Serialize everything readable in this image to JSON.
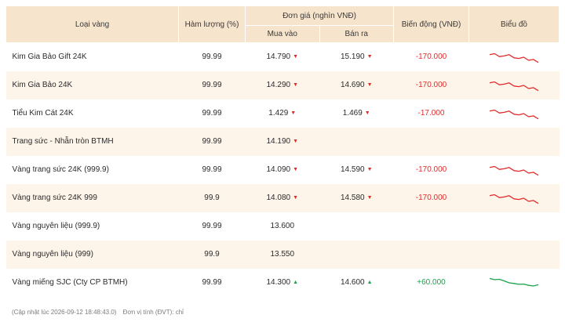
{
  "header": {
    "name": "Loại vàng",
    "purity": "Hàm lượng (%)",
    "price_group": "Đơn giá (nghìn VNĐ)",
    "buy": "Mua vào",
    "sell": "Bán ra",
    "change": "Biến động (VNĐ)",
    "chart": "Biểu đồ"
  },
  "rows": [
    {
      "name": "Kim Gia Bảo Gift 24K",
      "purity": "99.99",
      "buy": "14.790",
      "buy_dir": "down",
      "sell": "15.190",
      "sell_dir": "down",
      "change": "-170.000",
      "change_dir": "down",
      "trend_color": "#e02b2b",
      "trend": [
        0.3,
        0.22,
        0.45,
        0.4,
        0.3,
        0.55,
        0.6,
        0.5,
        0.75,
        0.68,
        0.92
      ]
    },
    {
      "name": "Kim Gia Bảo 24K",
      "purity": "99.99",
      "buy": "14.290",
      "buy_dir": "down",
      "sell": "14.690",
      "sell_dir": "down",
      "change": "-170.000",
      "change_dir": "down",
      "trend_color": "#e02b2b",
      "trend": [
        0.3,
        0.22,
        0.45,
        0.4,
        0.3,
        0.55,
        0.6,
        0.5,
        0.75,
        0.68,
        0.92
      ]
    },
    {
      "name": "Tiểu Kim Cát 24K",
      "purity": "99.99",
      "buy": "1.429",
      "buy_dir": "down",
      "sell": "1.469",
      "sell_dir": "down",
      "change": "-17.000",
      "change_dir": "down",
      "trend_color": "#e02b2b",
      "trend": [
        0.3,
        0.22,
        0.45,
        0.4,
        0.3,
        0.55,
        0.6,
        0.5,
        0.75,
        0.68,
        0.92
      ]
    },
    {
      "name": "Trang sức - Nhẫn tròn BTMH",
      "purity": "99.99",
      "buy": "14.190",
      "buy_dir": "down",
      "sell": "",
      "sell_dir": "",
      "change": "",
      "change_dir": "",
      "trend_color": "",
      "trend": []
    },
    {
      "name": "Vàng trang sức 24K (999.9)",
      "purity": "99.99",
      "buy": "14.090",
      "buy_dir": "down",
      "sell": "14.590",
      "sell_dir": "down",
      "change": "-170.000",
      "change_dir": "down",
      "trend_color": "#e02b2b",
      "trend": [
        0.3,
        0.22,
        0.45,
        0.4,
        0.3,
        0.55,
        0.6,
        0.5,
        0.75,
        0.68,
        0.92
      ]
    },
    {
      "name": "Vàng trang sức 24K 999",
      "purity": "99.9",
      "buy": "14.080",
      "buy_dir": "down",
      "sell": "14.580",
      "sell_dir": "down",
      "change": "-170.000",
      "change_dir": "down",
      "trend_color": "#e02b2b",
      "trend": [
        0.3,
        0.22,
        0.45,
        0.4,
        0.3,
        0.55,
        0.6,
        0.5,
        0.75,
        0.68,
        0.92
      ]
    },
    {
      "name": "Vàng nguyên liệu (999.9)",
      "purity": "99.99",
      "buy": "13.600",
      "buy_dir": "",
      "sell": "",
      "sell_dir": "",
      "change": "",
      "change_dir": "",
      "trend_color": "",
      "trend": []
    },
    {
      "name": "Vàng nguyên liệu (999)",
      "purity": "99.9",
      "buy": "13.550",
      "buy_dir": "",
      "sell": "",
      "sell_dir": "",
      "change": "",
      "change_dir": "",
      "trend_color": "",
      "trend": []
    },
    {
      "name": "Vàng miếng SJC (Cty CP BTMH)",
      "purity": "99.99",
      "buy": "14.300",
      "buy_dir": "up",
      "sell": "14.600",
      "sell_dir": "up",
      "change": "+60.000",
      "change_dir": "up",
      "trend_color": "#1aa34a",
      "trend": [
        0.15,
        0.25,
        0.22,
        0.35,
        0.5,
        0.55,
        0.62,
        0.6,
        0.7,
        0.75,
        0.65
      ]
    }
  ],
  "footer": {
    "updated": "(Cập nhật lúc 2026-09-12 18:48:43.0)",
    "unit": "Đơn vị tính (ĐVT): chỉ"
  }
}
